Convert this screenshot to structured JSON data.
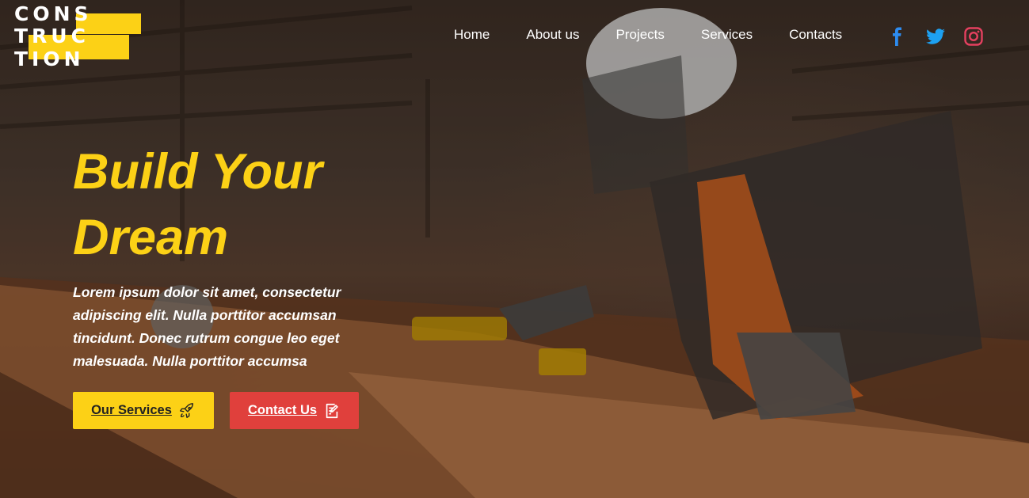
{
  "brand": {
    "logo_lines": [
      "CONS",
      "TRUC",
      "TION"
    ],
    "accent": "#fcd116"
  },
  "nav": {
    "items": [
      "Home",
      "About us",
      "Projects",
      "Services",
      "Contacts"
    ]
  },
  "social": {
    "icons": [
      "facebook-icon",
      "twitter-icon",
      "instagram-icon"
    ],
    "colors": {
      "facebook": "#2d8cf0",
      "twitter": "#1da1f2",
      "instagram": "#e4405f"
    }
  },
  "hero": {
    "headline_line1": "Build Your",
    "headline_line2": "Dream",
    "description": "Lorem ipsum dolor sit amet, consectetur adipiscing elit. Nulla porttitor accumsan tincidunt. Donec rutrum congue leo eget malesuada. Nulla porttitor accumsa",
    "primary_button": "Our Services",
    "secondary_button": "Contact Us",
    "primary_button_icon": "rocket-icon",
    "secondary_button_icon": "edit-note-icon",
    "primary_color": "#fcd116",
    "secondary_color": "#e0403c"
  }
}
